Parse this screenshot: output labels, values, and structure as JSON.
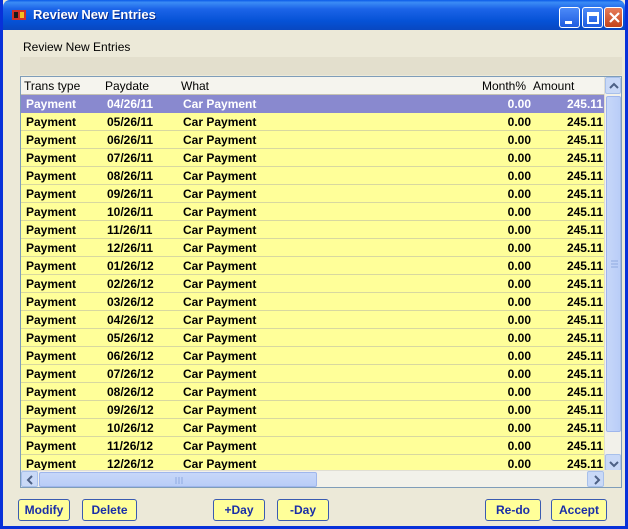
{
  "window": {
    "title": "Review New Entries",
    "subtitle": "Review New Entries"
  },
  "table": {
    "columns": [
      "Trans type",
      "Paydate",
      "What",
      "Month%",
      "Amount"
    ],
    "rows": [
      {
        "type": "Payment",
        "date": "04/26/11",
        "what": "Car Payment",
        "month": "0.00",
        "amount": "245.11",
        "selected": true
      },
      {
        "type": "Payment",
        "date": "05/26/11",
        "what": "Car Payment",
        "month": "0.00",
        "amount": "245.11"
      },
      {
        "type": "Payment",
        "date": "06/26/11",
        "what": "Car Payment",
        "month": "0.00",
        "amount": "245.11"
      },
      {
        "type": "Payment",
        "date": "07/26/11",
        "what": "Car Payment",
        "month": "0.00",
        "amount": "245.11"
      },
      {
        "type": "Payment",
        "date": "08/26/11",
        "what": "Car Payment",
        "month": "0.00",
        "amount": "245.11"
      },
      {
        "type": "Payment",
        "date": "09/26/11",
        "what": "Car Payment",
        "month": "0.00",
        "amount": "245.11"
      },
      {
        "type": "Payment",
        "date": "10/26/11",
        "what": "Car Payment",
        "month": "0.00",
        "amount": "245.11"
      },
      {
        "type": "Payment",
        "date": "11/26/11",
        "what": "Car Payment",
        "month": "0.00",
        "amount": "245.11"
      },
      {
        "type": "Payment",
        "date": "12/26/11",
        "what": "Car Payment",
        "month": "0.00",
        "amount": "245.11"
      },
      {
        "type": "Payment",
        "date": "01/26/12",
        "what": "Car Payment",
        "month": "0.00",
        "amount": "245.11"
      },
      {
        "type": "Payment",
        "date": "02/26/12",
        "what": "Car Payment",
        "month": "0.00",
        "amount": "245.11"
      },
      {
        "type": "Payment",
        "date": "03/26/12",
        "what": "Car Payment",
        "month": "0.00",
        "amount": "245.11"
      },
      {
        "type": "Payment",
        "date": "04/26/12",
        "what": "Car Payment",
        "month": "0.00",
        "amount": "245.11"
      },
      {
        "type": "Payment",
        "date": "05/26/12",
        "what": "Car Payment",
        "month": "0.00",
        "amount": "245.11"
      },
      {
        "type": "Payment",
        "date": "06/26/12",
        "what": "Car Payment",
        "month": "0.00",
        "amount": "245.11"
      },
      {
        "type": "Payment",
        "date": "07/26/12",
        "what": "Car Payment",
        "month": "0.00",
        "amount": "245.11"
      },
      {
        "type": "Payment",
        "date": "08/26/12",
        "what": "Car Payment",
        "month": "0.00",
        "amount": "245.11"
      },
      {
        "type": "Payment",
        "date": "09/26/12",
        "what": "Car Payment",
        "month": "0.00",
        "amount": "245.11"
      },
      {
        "type": "Payment",
        "date": "10/26/12",
        "what": "Car Payment",
        "month": "0.00",
        "amount": "245.11"
      },
      {
        "type": "Payment",
        "date": "11/26/12",
        "what": "Car Payment",
        "month": "0.00",
        "amount": "245.11"
      },
      {
        "type": "Payment",
        "date": "12/26/12",
        "what": "Car Payment",
        "month": "0.00",
        "amount": "245.11"
      }
    ]
  },
  "buttons": {
    "modify": "Modify",
    "delete": "Delete",
    "plus_day": "+Day",
    "minus_day": "-Day",
    "redo": "Re-do",
    "accept": "Accept"
  },
  "colors": {
    "row_background": "#ffff99",
    "selected_row": "#8989cf",
    "titlebar": "#0552d6",
    "button_text": "#1a2ea8"
  },
  "icons": {
    "app": "app-icon",
    "minimize": "minimize-icon",
    "maximize": "maximize-icon",
    "close": "close-icon",
    "scroll_up": "scroll-up-icon",
    "scroll_down": "scroll-down-icon",
    "scroll_left": "scroll-left-icon",
    "scroll_right": "scroll-right-icon"
  }
}
